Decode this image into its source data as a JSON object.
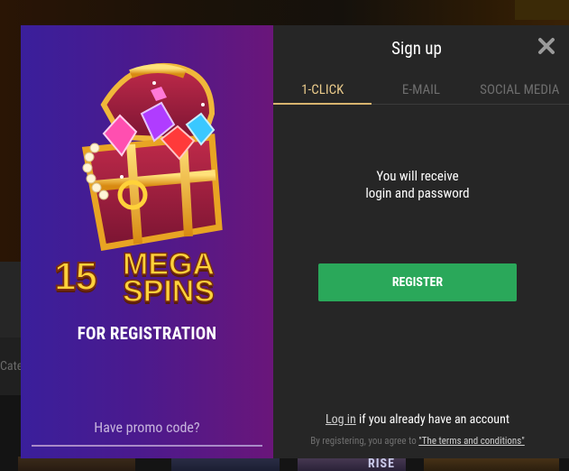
{
  "background": {
    "category_hint": "Cate",
    "thumb_text": "RISE"
  },
  "promo": {
    "bonus_number": "15",
    "bonus_title_line1": "MEGA",
    "bonus_title_line2": "SPINS",
    "bonus_subtitle": "FOR REGISTRATION",
    "promo_code_link": "Have promo code?"
  },
  "signup": {
    "title": "Sign up",
    "close_icon": "close-icon",
    "tabs": [
      {
        "label": "1-CLICK",
        "active": true
      },
      {
        "label": "E-MAIL",
        "active": false
      },
      {
        "label": "SOCIAL MEDIA",
        "active": false
      }
    ],
    "info_line1": "You will receive",
    "info_line2": "login and password",
    "register_label": "REGISTER",
    "login_link": "Log in",
    "login_suffix": " if you already have an account",
    "terms_prefix": "By registering, you agree to ",
    "terms_link": "\"The terms and conditions\""
  },
  "colors": {
    "accent_tab": "#e8c98a",
    "register_button": "#2aa85a",
    "bonus_gold": "#ffd23a",
    "promo_bg_left": "#3a1f9b",
    "promo_bg_right": "#6a167a"
  }
}
